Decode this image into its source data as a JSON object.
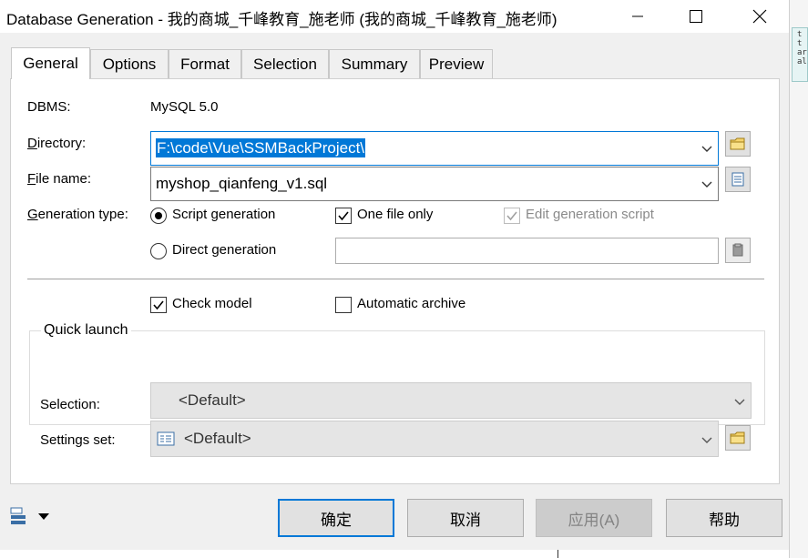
{
  "window": {
    "title": "Database Generation - 我的商城_千峰教育_施老师 (我的商城_千峰教育_施老师)"
  },
  "tabs": [
    {
      "label": "General",
      "active": true
    },
    {
      "label": "Options",
      "active": false
    },
    {
      "label": "Format",
      "active": false
    },
    {
      "label": "Selection",
      "active": false
    },
    {
      "label": "Summary",
      "active": false
    },
    {
      "label": "Preview",
      "active": false
    }
  ],
  "general": {
    "dbms_label": "DBMS:",
    "dbms_value": "MySQL 5.0",
    "directory_label": "Directory:",
    "directory_value": "F:\\code\\Vue\\SSMBackProject\\",
    "filename_label": "File name:",
    "filename_value": "myshop_qianfeng_v1.sql",
    "generation_type_label": "Generation type:",
    "script_generation": "Script generation",
    "direct_generation": "Direct generation",
    "one_file_only": "One file only",
    "edit_generation_script": "Edit generation script",
    "direct_generation_value": "",
    "check_model": "Check model",
    "automatic_archive": "Automatic archive"
  },
  "state": {
    "script_generation_selected": true,
    "one_file_only_checked": true,
    "edit_generation_script_checked": true,
    "check_model_checked": true,
    "automatic_archive_checked": false
  },
  "quick_launch": {
    "legend": "Quick launch",
    "selection_label": "Selection:",
    "selection_value": "<Default>",
    "settings_label": "Settings set:",
    "settings_value": "<Default>"
  },
  "buttons": {
    "ok": "确定",
    "cancel": "取消",
    "apply": "应用(A)",
    "help": "帮助"
  },
  "background_snippet": "t\nt\nar\nal",
  "colors": {
    "accent": "#0078d7",
    "dialog_bg": "#f0f0f0",
    "panel_bg": "#ffffff"
  }
}
